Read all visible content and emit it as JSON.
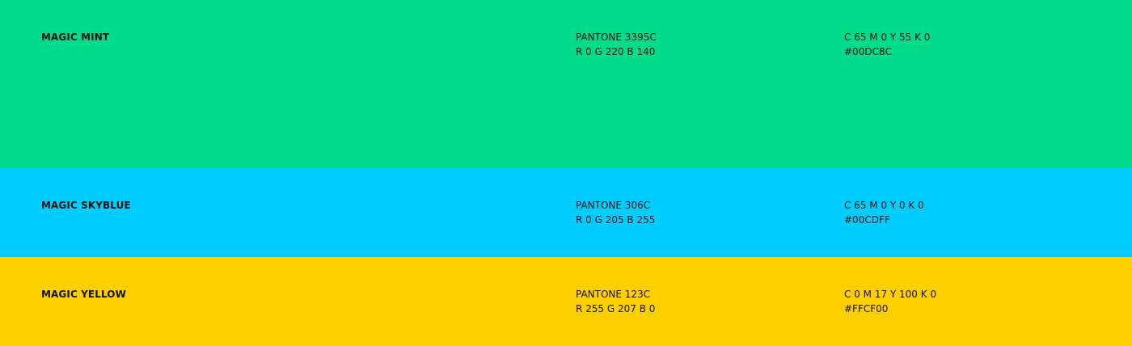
{
  "swatches": [
    {
      "name": "MAGIC MINT",
      "pantone": "PANTONE 3395C",
      "rgb": "R 0 G 220 B 140",
      "cmyk": "C 65 M 0 Y 55 K 0",
      "hex": "#00DC8C",
      "color": "#00DC8C"
    },
    {
      "name": "MAGIC SKYBLUE",
      "pantone": "PANTONE 306C",
      "rgb": "R 0 G 205 B 255",
      "cmyk": "C 65 M 0 Y 0 K 0",
      "hex": "#00CDFF",
      "color": "#00CDFF"
    },
    {
      "name": "MAGIC YELLOW",
      "pantone": "PANTONE 123C",
      "rgb": "R 255 G 207 B 0",
      "cmyk": "C 0 M 17 Y 100 K 0",
      "hex": "#FFCF00",
      "color": "#FFCF00"
    }
  ]
}
